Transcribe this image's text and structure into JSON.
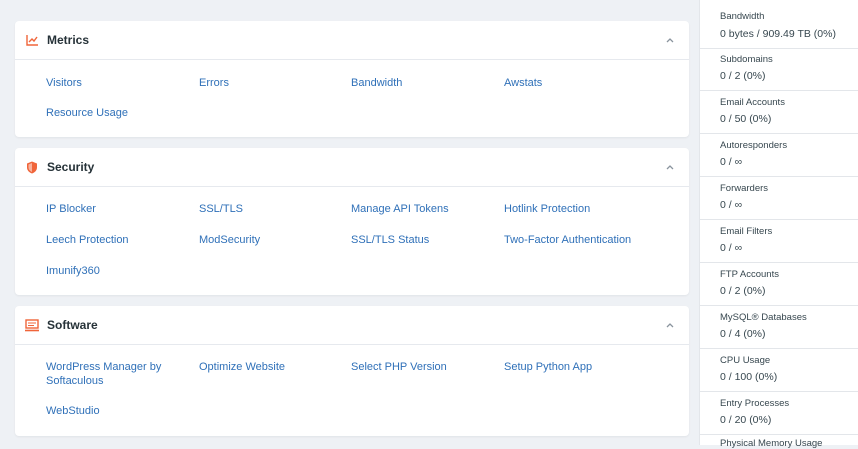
{
  "colors": {
    "link": "#2f70b8",
    "metrics_icon": "#f0653a",
    "security_icon": "#f0653a",
    "software_icon": "#f0653a"
  },
  "metrics": {
    "title": "Metrics",
    "icon": "chart-line-icon",
    "links": [
      "Visitors",
      "Errors",
      "Bandwidth",
      "Awstats",
      "Resource Usage"
    ]
  },
  "security": {
    "title": "Security",
    "icon": "shield-icon",
    "links": [
      "IP Blocker",
      "SSL/TLS",
      "Manage API Tokens",
      "Hotlink Protection",
      "Leech Protection",
      "ModSecurity",
      "SSL/TLS Status",
      "Two-Factor Authentication",
      "Imunify360"
    ]
  },
  "software": {
    "title": "Software",
    "icon": "monitor-icon",
    "links": [
      "WordPress Manager by Softaculous",
      "Optimize Website",
      "Select PHP Version",
      "Setup Python App",
      "WebStudio"
    ]
  },
  "stats": [
    {
      "label": "Bandwidth",
      "value": "0 bytes / 909.49 TB   (0%)"
    },
    {
      "label": "Subdomains",
      "value": "0 / 2   (0%)"
    },
    {
      "label": "Email Accounts",
      "value": "0 / 50   (0%)"
    },
    {
      "label": "Autoresponders",
      "value": "0 / ∞"
    },
    {
      "label": "Forwarders",
      "value": "0 / ∞"
    },
    {
      "label": "Email Filters",
      "value": "0 / ∞"
    },
    {
      "label": "FTP Accounts",
      "value": "0 / 2   (0%)"
    },
    {
      "label": "MySQL® Databases",
      "value": "0 / 4   (0%)"
    },
    {
      "label": "CPU Usage",
      "value": "0 / 100   (0%)"
    },
    {
      "label": "Entry Processes",
      "value": "0 / 20   (0%)"
    },
    {
      "label": "Physical Memory Usage",
      "value": ""
    }
  ]
}
